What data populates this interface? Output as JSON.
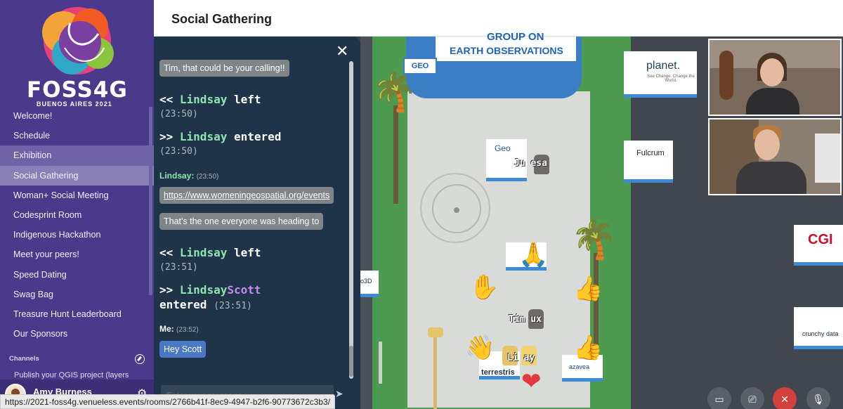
{
  "sidebar": {
    "logo_text": "FOSS4G",
    "logo_subtitle": "BUENOS AIRES 2021",
    "nav": [
      {
        "label": "Welcome!"
      },
      {
        "label": "Schedule"
      },
      {
        "label": "Exhibition"
      },
      {
        "label": "Social Gathering"
      },
      {
        "label": "Woman+ Social Meeting"
      },
      {
        "label": "Codesprint Room"
      },
      {
        "label": "Indigenous Hackathon"
      },
      {
        "label": "Meet your peers!"
      },
      {
        "label": "Speed Dating"
      },
      {
        "label": "Swag Bag"
      },
      {
        "label": "Treasure Hunt Leaderboard"
      },
      {
        "label": "Our Sponsors"
      }
    ],
    "channels_label": "Channels",
    "channel_item": "Publish your QGIS project (layers",
    "user_name": "Amy Burness"
  },
  "header": {
    "title": "Social Gathering"
  },
  "chat": {
    "msg1": "Tim, that could be your calling!!",
    "sys1": {
      "arrow": "<<",
      "name": "Lindsay",
      "action": "left",
      "time": "(23:50)"
    },
    "sys2": {
      "arrow": ">>",
      "name": "Lindsay",
      "action": "entered",
      "time": "(23:50)"
    },
    "sender1": {
      "name": "Lindsay:",
      "time": "(23:50)"
    },
    "msg2": "https://www.womeningeospatial.org/events",
    "msg3": "That's the one everyone was heading to",
    "sys3": {
      "arrow": "<<",
      "name": "Lindsay",
      "action": "left",
      "time": "(23:51)"
    },
    "sys4": {
      "arrow": ">>",
      "name": "Lindsay",
      "name2": "Scott",
      "action": "entered",
      "time": "(23:51)"
    },
    "sender2": {
      "name": "Me:",
      "time": "(23:52)"
    },
    "msg4": "Hey Scott",
    "input_placeholder": "Enter your message"
  },
  "map": {
    "geo_line1": "GROUP ON",
    "geo_line2": "EARTH OBSERVATIONS",
    "geo_small": "GEO",
    "booth_planet": "planet.",
    "booth_planet_sub": "See Change. Change the World.",
    "booth_fulcrum": "Fulcrum",
    "booth_cgi": "CGI",
    "booth_crunchy": "crunchy data",
    "booth_geo": "Geo",
    "booth_terrestris": "terrestris",
    "booth_azavea": "azavea",
    "booth_3d": "o3D",
    "name_jesa": "Ju   esa",
    "name_tim": "Tim    ux",
    "name_lin": "Li    ay"
  },
  "status_url": "https://2021-foss4g.venueless.events/rooms/2766b41f-8ec9-4947-b2f6-90773672c3b3/"
}
